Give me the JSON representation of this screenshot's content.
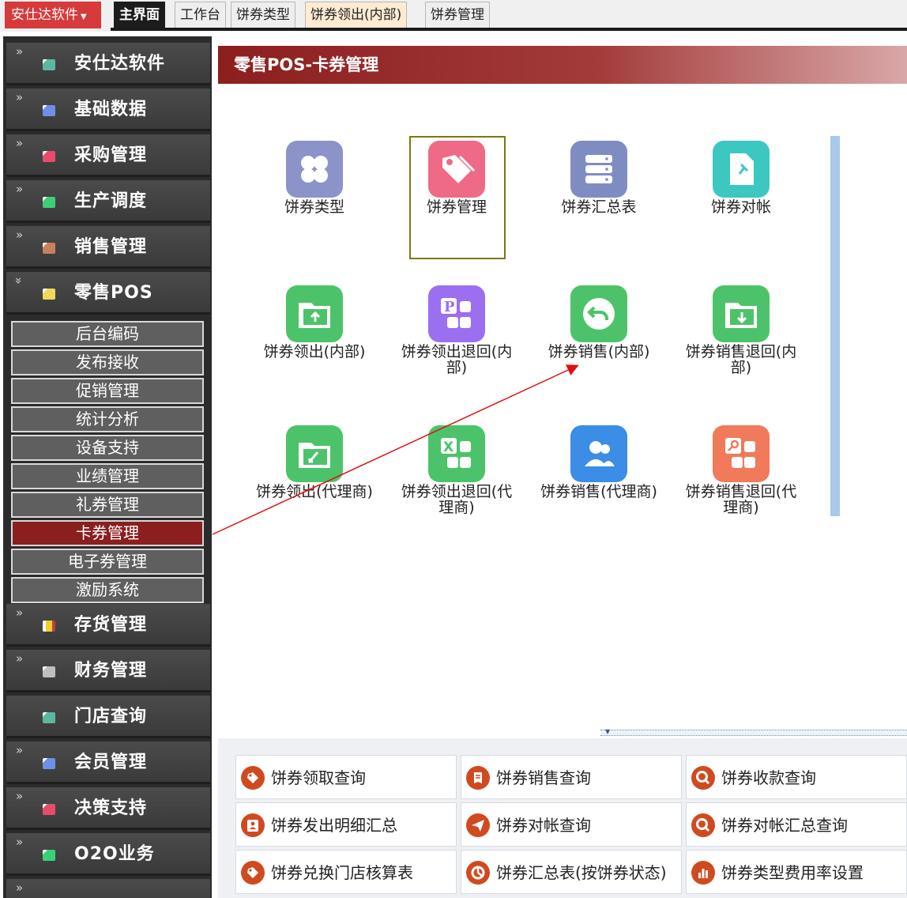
{
  "topbar": {
    "app_menu": "安仕达软件",
    "tabs": [
      "主界面",
      "工作台",
      "饼券类型",
      "饼券领出(内部)",
      "饼券管理"
    ]
  },
  "sidebar": {
    "items": [
      {
        "label": "安仕达软件",
        "color": "#5fb6a0",
        "chevron": "»"
      },
      {
        "label": "基础数据",
        "color": "#6f8fe6",
        "chevron": "»"
      },
      {
        "label": "采购管理",
        "color": "#e84c6d",
        "chevron": "»"
      },
      {
        "label": "生产调度",
        "color": "#3ccf7a",
        "chevron": "»"
      },
      {
        "label": "销售管理",
        "color": "#c8815f",
        "chevron": "»"
      },
      {
        "label": "零售POS",
        "color": "#f0d85a",
        "chevron": "«"
      }
    ],
    "subitems": [
      "后台编码",
      "发布接收",
      "促销管理",
      "统计分析",
      "设备支持",
      "业绩管理",
      "礼券管理",
      "卡券管理",
      "电子券管理",
      "激励系统"
    ],
    "active_sub": "卡券管理",
    "items_after": [
      {
        "label": "存货管理",
        "color": "#f0d030",
        "chevron": "»"
      },
      {
        "label": "财务管理",
        "color": "#bfbfbf",
        "chevron": "»"
      },
      {
        "label": "门店查询",
        "color": "#5fb6a0",
        "chevron": ""
      },
      {
        "label": "会员管理",
        "color": "#6f8fe6",
        "chevron": "»"
      },
      {
        "label": "决策支持",
        "color": "#e84c6d",
        "chevron": "»"
      },
      {
        "label": "O2O业务",
        "color": "#3ccf7a",
        "chevron": "»"
      }
    ]
  },
  "panel": {
    "title": "零售POS-卡券管理",
    "grid": [
      {
        "label": "饼券类型",
        "icon": "four-leaf-grid-icon",
        "color": "#8b93c9"
      },
      {
        "label": "饼券管理",
        "icon": "tag-icon",
        "color": "#ee6a86"
      },
      {
        "label": "饼券汇总表",
        "icon": "server-stack-icon",
        "color": "#7f8cc2"
      },
      {
        "label": "饼券对帐",
        "icon": "pin-document-icon",
        "color": "#3cc8c0"
      },
      {
        "label": "饼券领出(内部)",
        "icon": "folder-upload-icon",
        "color": "#4cc36a"
      },
      {
        "label": "饼券领出退回(内部)",
        "icon": "p-grid-icon",
        "color": "#9b6ff0"
      },
      {
        "label": "饼券销售(内部)",
        "icon": "undo-circle-icon",
        "color": "#4cc36a"
      },
      {
        "label": "饼券销售退回(内部)",
        "icon": "folder-download-icon",
        "color": "#4cc36a"
      },
      {
        "label": "饼券领出(代理商)",
        "icon": "folder-refresh-icon",
        "color": "#4cc36a"
      },
      {
        "label": "饼券领出退回(代理商)",
        "icon": "excel-grid-icon",
        "color": "#4cc36a"
      },
      {
        "label": "饼券销售(代理商)",
        "icon": "users-icon",
        "color": "#3b8de6"
      },
      {
        "label": "饼券销售退回(代理商)",
        "icon": "key-grid-icon",
        "color": "#f07a5a"
      }
    ]
  },
  "links": [
    {
      "label": "饼券领取查询",
      "icon": "tag-circle-icon",
      "color": "#d04a20"
    },
    {
      "label": "饼券销售查询",
      "icon": "receipt-circle-icon",
      "color": "#d04a20"
    },
    {
      "label": "饼券收款查询",
      "icon": "search-circle-icon",
      "color": "#d04a20"
    },
    {
      "label": "饼券发出明细汇总",
      "icon": "contact-card-icon",
      "color": "#d04a20"
    },
    {
      "label": "饼券对帐查询",
      "icon": "send-circle-icon",
      "color": "#d04a20"
    },
    {
      "label": "饼券对帐汇总查询",
      "icon": "search-circle-icon",
      "color": "#d04a20"
    },
    {
      "label": "饼券兑换门店核算表",
      "icon": "tag-circle-icon",
      "color": "#d04a20"
    },
    {
      "label": "饼券汇总表(按饼券状态)",
      "icon": "pie-chart-circle-icon",
      "color": "#d04a20"
    },
    {
      "label": "饼券类型费用率设置",
      "icon": "bar-chart-circle-icon",
      "color": "#d04a20"
    }
  ]
}
